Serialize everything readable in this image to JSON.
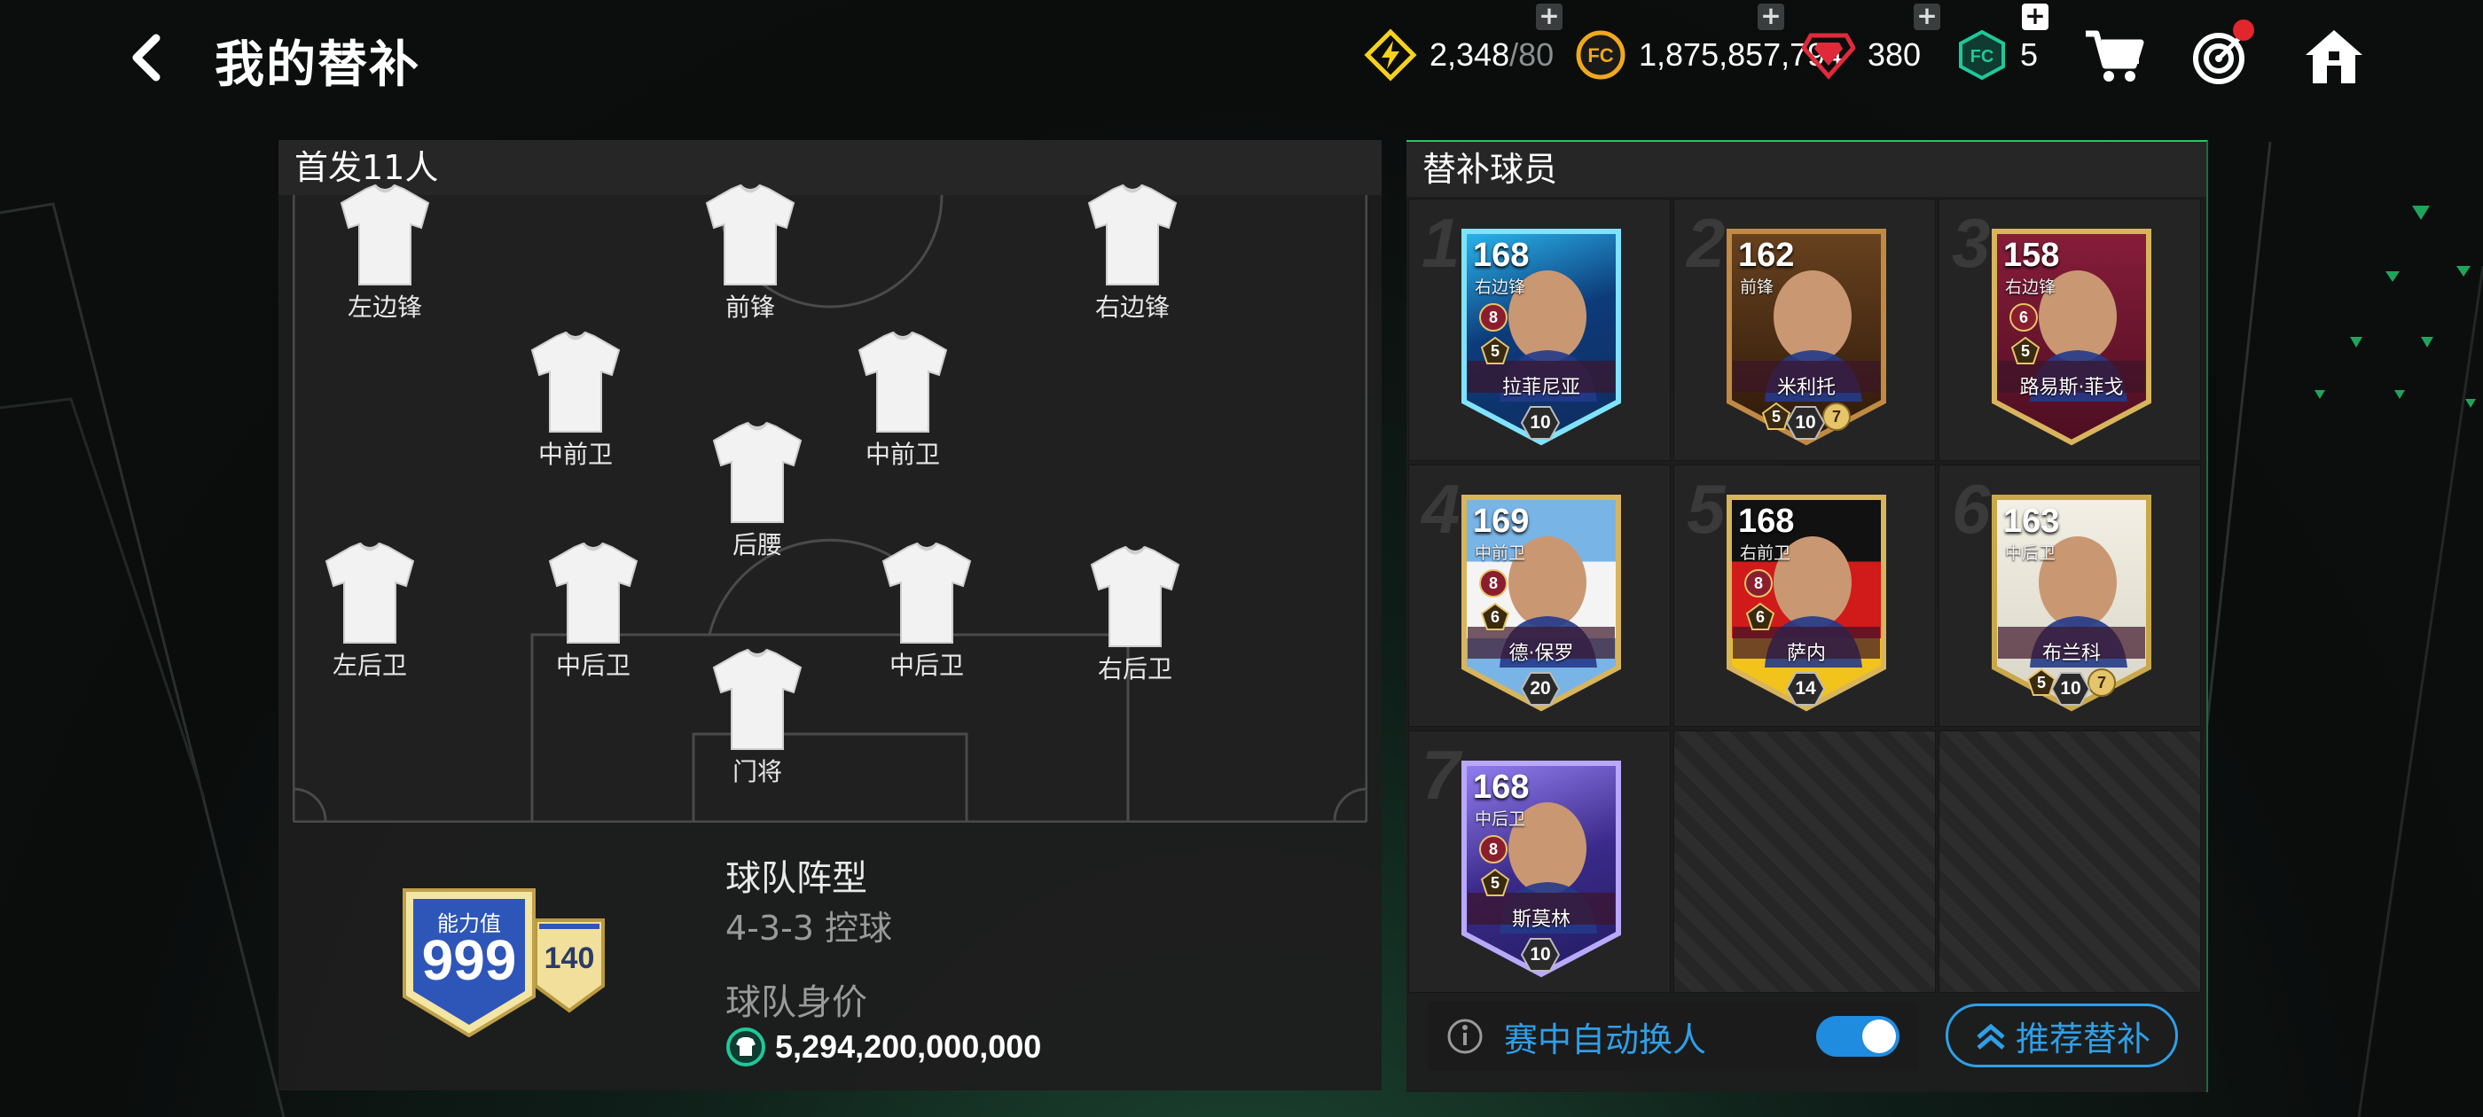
{
  "header": {
    "title": "我的替补",
    "back_icon": "chevron-left-icon"
  },
  "currencies": [
    {
      "icon": "energy-bolt-icon",
      "value": "2,348",
      "max": "/80",
      "color": "#f5d31a"
    },
    {
      "icon": "fc-coin-icon",
      "value": "1,875,857,794",
      "color": "#f0a81c"
    },
    {
      "icon": "ruby-gem-icon",
      "value": "380",
      "color": "#e02a3a"
    },
    {
      "icon": "fc-point-icon",
      "value": "5",
      "color": "#1fc89a"
    }
  ],
  "top_icons": [
    "cart-icon",
    "target-icon",
    "home-icon"
  ],
  "starting_panel": {
    "title": "首发11人",
    "positions": [
      {
        "label": "左边锋"
      },
      {
        "label": "前锋"
      },
      {
        "label": "右边锋"
      },
      {
        "label": "中前卫"
      },
      {
        "label": "中前卫"
      },
      {
        "label": "后腰"
      },
      {
        "label": "左后卫"
      },
      {
        "label": "中后卫"
      },
      {
        "label": "中后卫"
      },
      {
        "label": "右后卫"
      },
      {
        "label": "门将"
      }
    ],
    "rating_label": "能力值",
    "rating_value": "999",
    "secondary_rating": "140",
    "formation_title": "球队阵型",
    "formation_value": "4-3-3 控球",
    "team_value_title": "球队身价",
    "team_value": "5,294,200,000,000"
  },
  "subs_panel": {
    "title": "替补球员",
    "players": [
      {
        "slot": "1",
        "ovr": "168",
        "pos": "右边锋",
        "name": "拉菲尼亚",
        "b1": "8",
        "b2": "5",
        "level": "10",
        "theme": "ice"
      },
      {
        "slot": "2",
        "ovr": "162",
        "pos": "前锋",
        "name": "米利托",
        "b1": "",
        "b2": "",
        "level": "10",
        "extra_left": "5",
        "extra_right": "7",
        "theme": "bronze"
      },
      {
        "slot": "3",
        "ovr": "158",
        "pos": "右边锋",
        "name": "路易斯·菲戈",
        "b1": "6",
        "b2": "5",
        "level": "",
        "theme": "wine"
      },
      {
        "slot": "4",
        "ovr": "169",
        "pos": "中前卫",
        "name": "德·保罗",
        "b1": "8",
        "b2": "6",
        "level": "20",
        "theme": "argentina"
      },
      {
        "slot": "5",
        "ovr": "168",
        "pos": "右前卫",
        "name": "萨内",
        "b1": "8",
        "b2": "6",
        "level": "14",
        "theme": "germany"
      },
      {
        "slot": "6",
        "ovr": "163",
        "pos": "中后卫",
        "name": "布兰科",
        "b1": "",
        "b2": "",
        "level": "10",
        "extra_left": "5",
        "extra_right": "7",
        "theme": "white"
      },
      {
        "slot": "7",
        "ovr": "168",
        "pos": "中后卫",
        "name": "斯莫林",
        "b1": "8",
        "b2": "5",
        "level": "10",
        "theme": "purple"
      }
    ],
    "auto_sub_label": "赛中自动换人",
    "auto_sub_on": true,
    "recommend_label": "推荐替补"
  }
}
